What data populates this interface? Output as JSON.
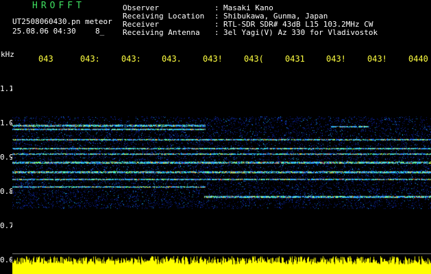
{
  "header": {
    "title": "HROFFT",
    "filename": "UT2508060430.pn",
    "mode": "meteor",
    "datetime": "25.08.06 04:30",
    "counter": "8_",
    "info": [
      {
        "label": "Observer",
        "value": "Masaki Kano"
      },
      {
        "label": "Receiving Location",
        "value": "Shibukawa, Gunma, Japan"
      },
      {
        "label": "Receiver",
        "value": "RTL-SDR SDR# 43dB L15 103.2MHz CW"
      },
      {
        "label": "Receiving Antenna",
        "value": "3el Yagi(V) Az 330 for Vladivostok"
      }
    ]
  },
  "axis": {
    "unit": "kHz",
    "time_ticks": [
      "043",
      "043:",
      "043:",
      "043.",
      "043!",
      "043(",
      "0431",
      "043!",
      "043!",
      "0440"
    ],
    "freq_ticks": [
      "1.1",
      "1.0",
      "0.9",
      "0.8",
      "0.7",
      "0.6"
    ]
  },
  "colors": {
    "title": "#3fe060",
    "ticks": "#ffff40",
    "background": "#000000",
    "noise": "#ffff00"
  }
}
